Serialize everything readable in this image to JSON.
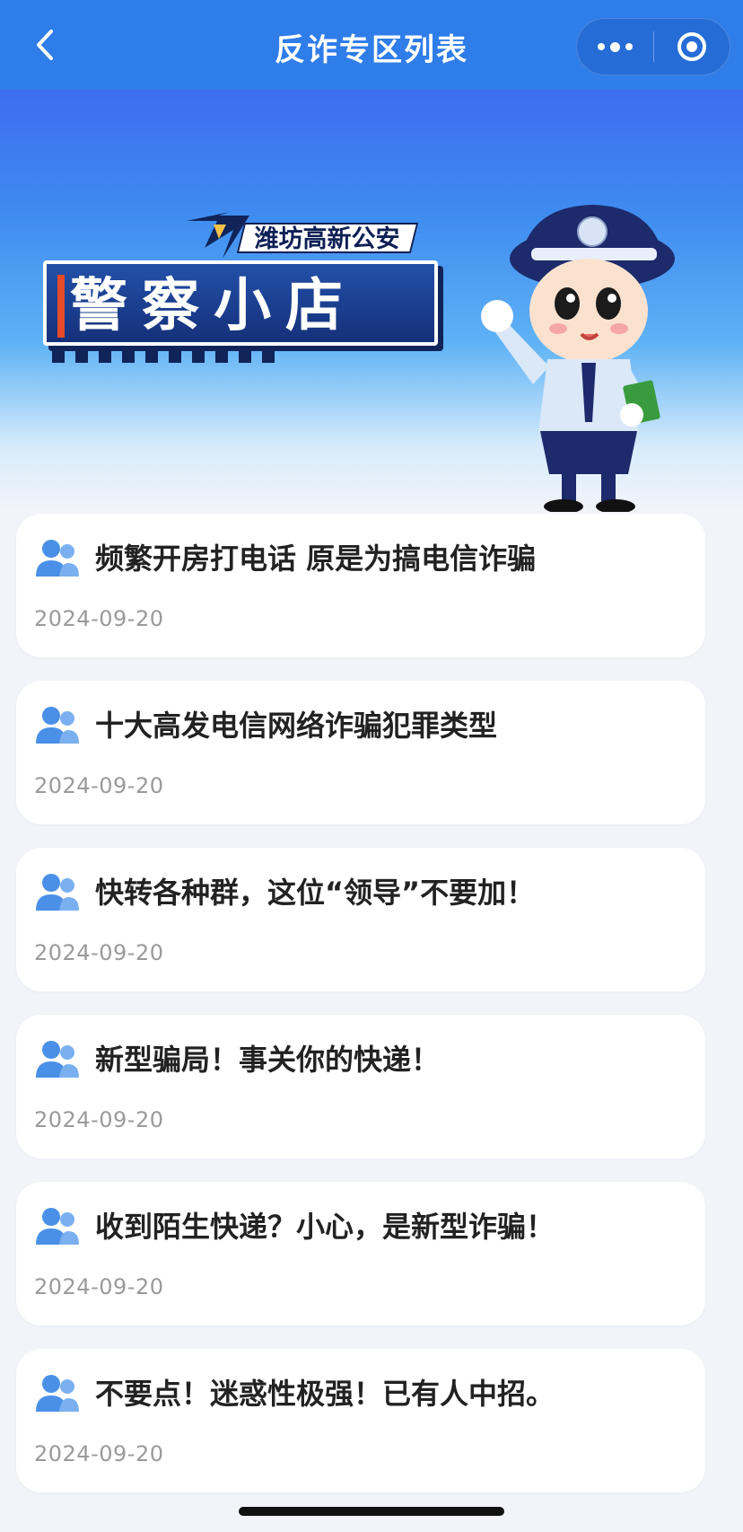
{
  "navbar": {
    "title": "反诈专区列表",
    "back_icon": "chevron-left-icon",
    "more_icon": "more-dots-icon",
    "close_icon": "target-circle-icon"
  },
  "banner": {
    "sign_subtitle": "潍坊高新公安",
    "sign_title": "警察小店",
    "colors": {
      "bg_top": "#3e6cf0",
      "sign_blue": "#15307a",
      "stripe": "#e64c2a"
    }
  },
  "articles": [
    {
      "title": "频繁开房打电话 原是为搞电信诈骗",
      "date": "2024-09-20",
      "icon": "users-icon"
    },
    {
      "title": "十大高发电信网络诈骗犯罪类型",
      "date": "2024-09-20",
      "icon": "users-icon"
    },
    {
      "title": "快转各种群，这位“领导”不要加！",
      "date": "2024-09-20",
      "icon": "users-icon"
    },
    {
      "title": "新型骗局！事关你的快递！",
      "date": "2024-09-20",
      "icon": "users-icon"
    },
    {
      "title": "收到陌生快递？小心，是新型诈骗！",
      "date": "2024-09-20",
      "icon": "users-icon"
    },
    {
      "title": "不要点！迷惑性极强！已有人中招。",
      "date": "2024-09-20",
      "icon": "users-icon"
    }
  ],
  "theme": {
    "nav_color": "#2f7de9",
    "icon_color": "#4a90e8",
    "date_color": "#9a9a9a"
  }
}
